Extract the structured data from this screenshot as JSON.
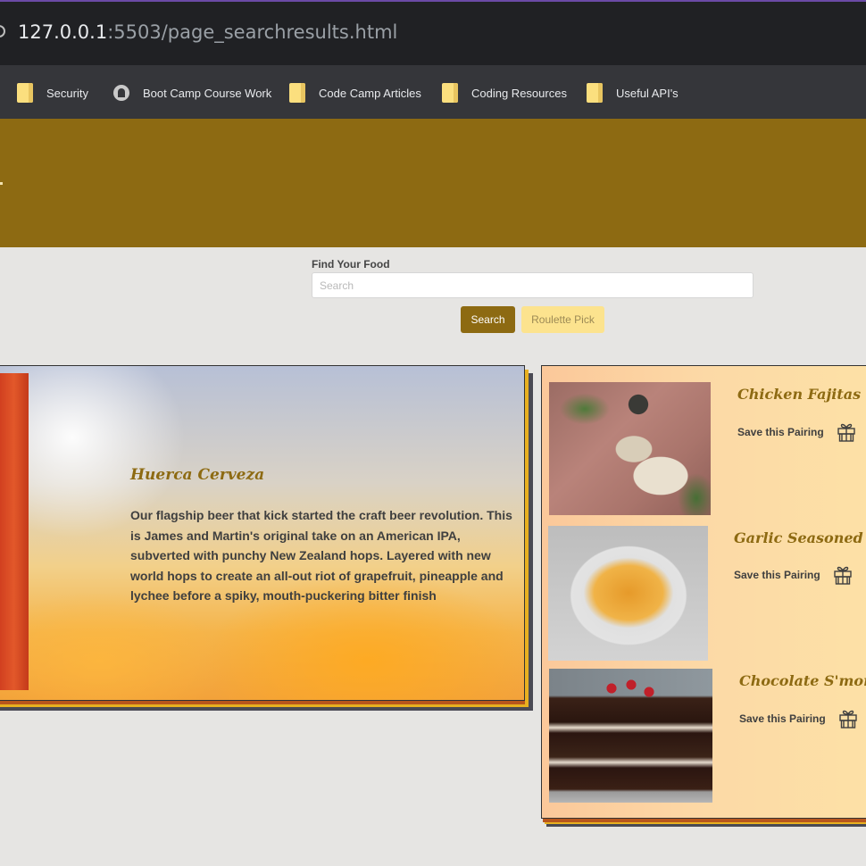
{
  "browser": {
    "url_host": "127.0.0.1",
    "url_rest": ":5503/page_searchresults.html",
    "bookmarks": [
      {
        "label": "Security",
        "icon": "folder-icon"
      },
      {
        "label": "Boot Camp Course Work",
        "icon": "github-icon"
      },
      {
        "label": "Code Camp Articles",
        "icon": "folder-icon"
      },
      {
        "label": "Coding Resources",
        "icon": "folder-icon"
      },
      {
        "label": "Useful API's",
        "icon": "folder-icon"
      }
    ]
  },
  "search": {
    "label": "Find Your Food",
    "placeholder": "Search",
    "value": "",
    "search_button": "Search",
    "roulette_button": "Roulette Pick"
  },
  "beer": {
    "name": "Huerca Cerveza",
    "description": "Our flagship beer that kick started the craft beer revolution. This is James and Martin's original take on an American IPA, subverted with punchy New Zealand hops. Layered with new world hops to create an all-out riot of grapefruit, pineapple and lychee before a spiky, mouth-puckering bitter finish"
  },
  "pairings": [
    {
      "name": "Chicken Fajitas",
      "save_label": "Save this Pairing"
    },
    {
      "name": "Garlic Seasoned F",
      "save_label": "Save this Pairing"
    },
    {
      "name": "Chocolate S'more",
      "save_label": "Save this Pairing"
    }
  ],
  "colors": {
    "brand": "#8d6a12",
    "accent": "#fce38e",
    "page_bg": "#e6e5e3"
  }
}
